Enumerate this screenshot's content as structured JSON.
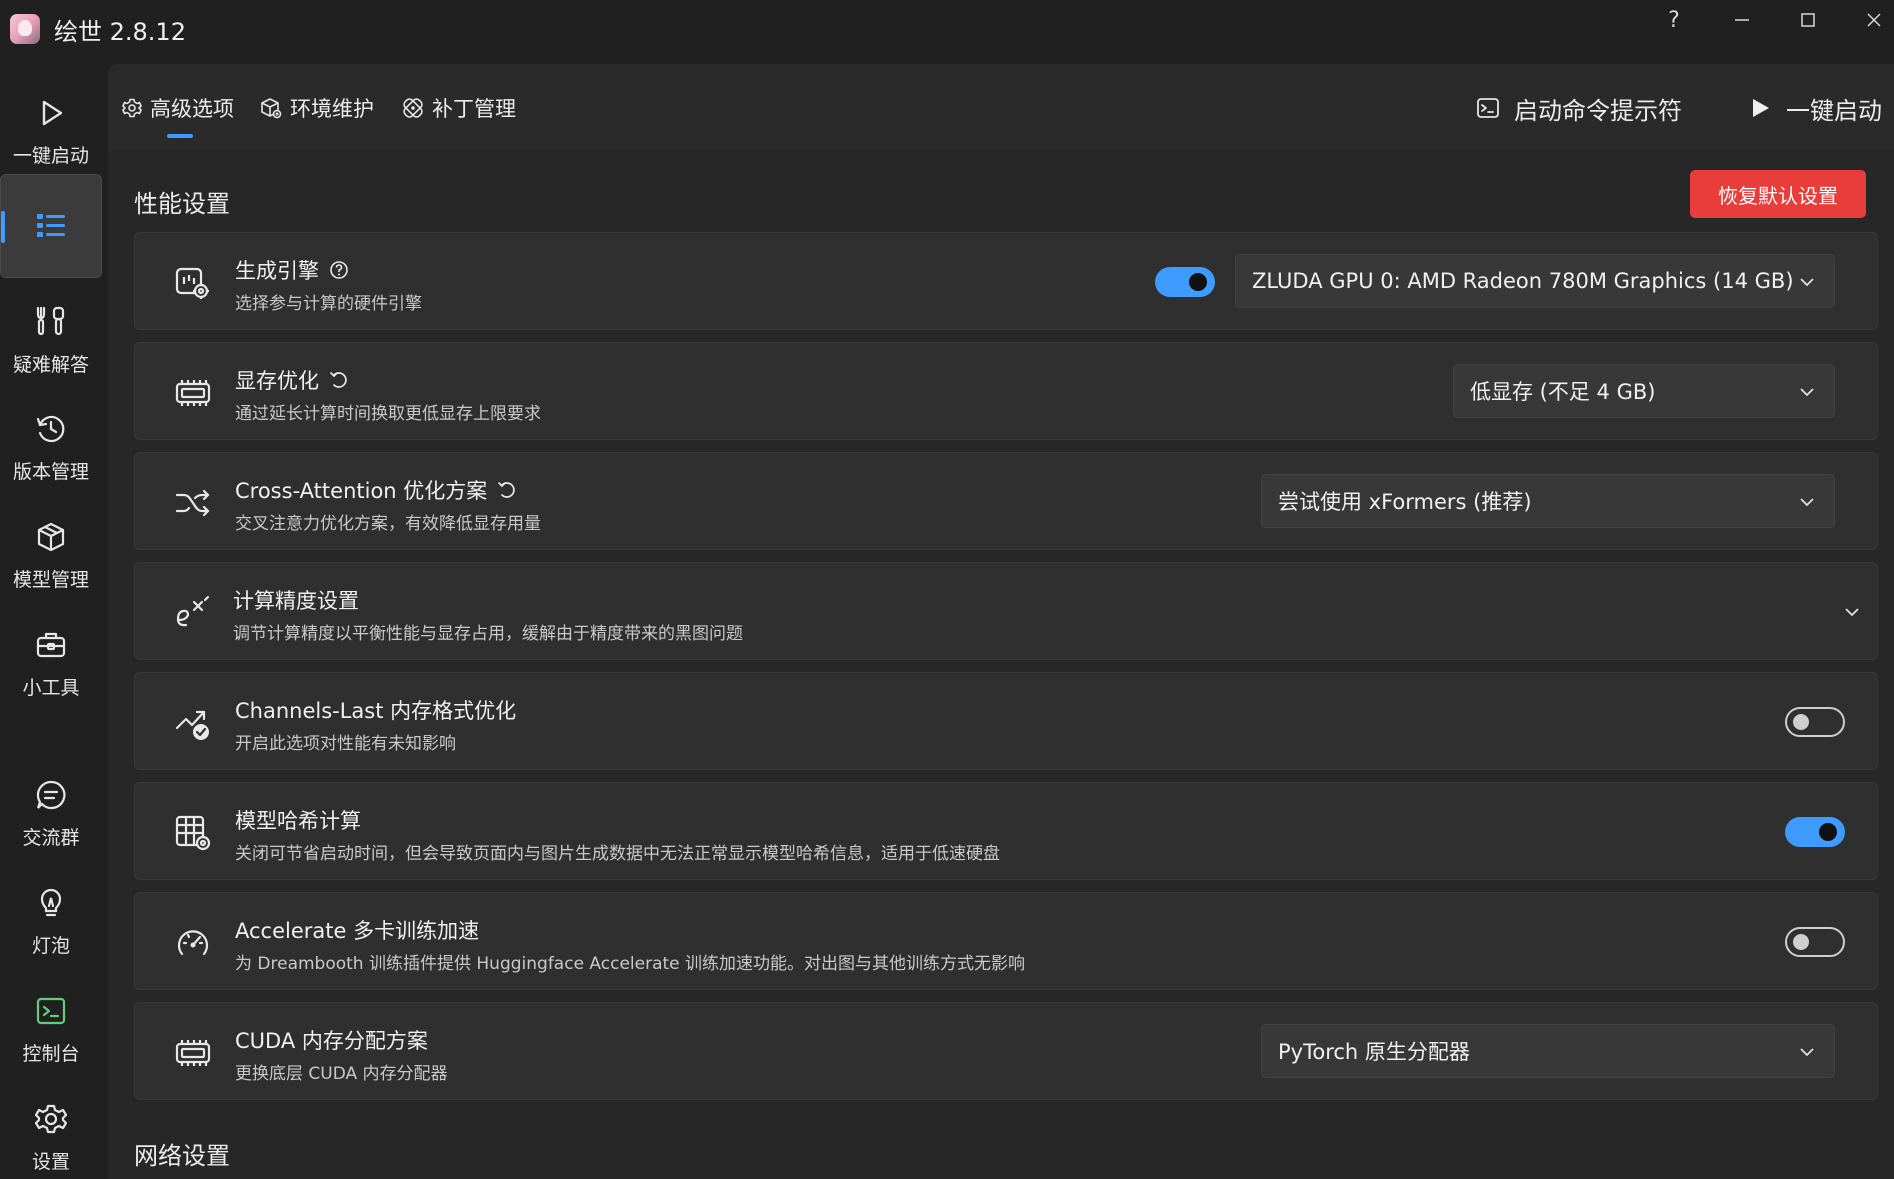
{
  "app": {
    "title": "绘世 2.8.12"
  },
  "window_controls": [
    {
      "name": "help",
      "glyph": "?"
    },
    {
      "name": "minimize",
      "glyph": "—"
    },
    {
      "name": "maximize",
      "glyph": "□"
    },
    {
      "name": "close",
      "glyph": "✕"
    }
  ],
  "sidebar": {
    "items": [
      {
        "label": "一键启动",
        "icon": "play-icon"
      },
      {
        "label": "",
        "icon": "list-icon",
        "active": true
      },
      {
        "label": "疑难解答",
        "icon": "tools-icon"
      },
      {
        "label": "版本管理",
        "icon": "history-icon"
      },
      {
        "label": "模型管理",
        "icon": "cube-icon"
      },
      {
        "label": "小工具",
        "icon": "toolbox-icon"
      },
      {
        "label": "交流群",
        "icon": "chat-icon"
      },
      {
        "label": "灯泡",
        "icon": "bulb-icon"
      },
      {
        "label": "控制台",
        "icon": "console-icon"
      },
      {
        "label": "设置",
        "icon": "gear-icon"
      }
    ]
  },
  "tabs": [
    {
      "label": "高级选项",
      "icon": "gear-icon",
      "active": true
    },
    {
      "label": "环境维护",
      "icon": "package-icon"
    },
    {
      "label": "补丁管理",
      "icon": "patch-icon"
    }
  ],
  "topbar": {
    "console_label": "启动命令提示符",
    "launch_label": "一键启动"
  },
  "performance": {
    "section_title": "性能设置",
    "reset_label": "恢复默认设置",
    "cards": [
      {
        "title": "生成引擎",
        "desc": "选择参与计算的硬件引擎",
        "icon": "engine-icon",
        "toggle": "on",
        "select": "ZLUDA GPU 0: AMD Radeon 780M Graphics (14 GB)"
      },
      {
        "title": "显存优化",
        "desc": "通过延长计算时间换取更低显存上限要求",
        "icon": "memory-icon",
        "select": "低显存 (不足 4 GB)"
      },
      {
        "title": "Cross-Attention 优化方案",
        "desc": "交叉注意力优化方案，有效降低显存用量",
        "icon": "shuffle-icon",
        "select": "尝试使用 xFormers (推荐)"
      },
      {
        "title": "计算精度设置",
        "desc": "调节计算精度以平衡性能与显存占用，缓解由于精度带来的黑图问题",
        "icon": "exponent-icon"
      },
      {
        "title": "Channels-Last 内存格式优化",
        "desc": "开启此选项对性能有未知影响",
        "icon": "chart-check-icon",
        "toggle": "off"
      },
      {
        "title": "模型哈希计算",
        "desc": "关闭可节省启动时间，但会导致页面内与图片生成数据中无法正常显示模型哈希信息，适用于低速硬盘",
        "icon": "table-gear-icon",
        "toggle": "on"
      },
      {
        "title": "Accelerate 多卡训练加速",
        "desc": "为 Dreambooth 训练插件提供 Huggingface Accelerate 训练加速功能。对出图与其他训练方式无影响",
        "icon": "gauge-icon",
        "toggle": "off"
      },
      {
        "title": "CUDA 内存分配方案",
        "desc": "更换底层 CUDA 内存分配器",
        "icon": "memory-icon",
        "select": "PyTorch 原生分配器"
      }
    ]
  },
  "network": {
    "section_title": "网络设置"
  },
  "colors": {
    "accent": "#3e9bff",
    "danger": "#e83d3b",
    "background": "#202020",
    "card": "#2f2f2f"
  }
}
